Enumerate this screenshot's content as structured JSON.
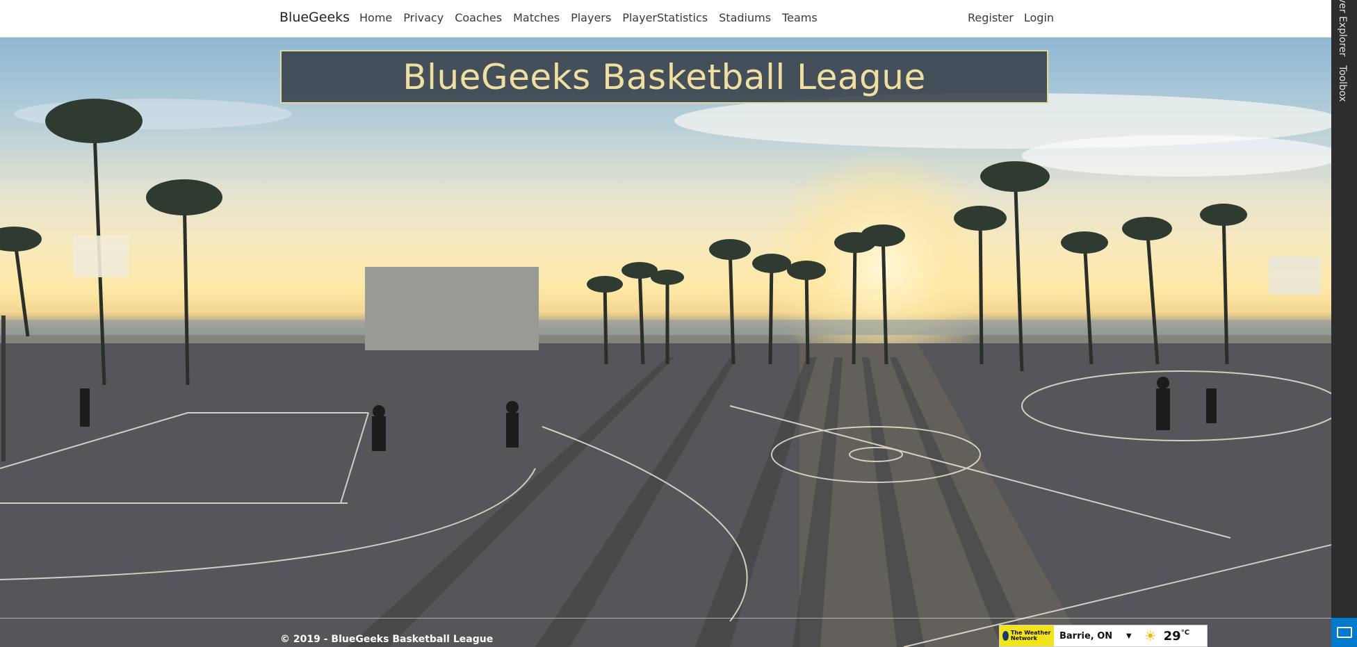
{
  "navbar": {
    "brand": "BlueGeeks",
    "links": [
      "Home",
      "Privacy",
      "Coaches",
      "Matches",
      "Players",
      "PlayerStatistics",
      "Stadiums",
      "Teams"
    ],
    "right_links": [
      "Register",
      "Login"
    ]
  },
  "hero": {
    "title": "BlueGeeks Basketball League",
    "scene": "outdoor-basketball-courts-sunset"
  },
  "footer": {
    "text": "© 2019 - BlueGeeks Basketball League"
  },
  "weather": {
    "provider": "The Weather Network",
    "city": "Barrie, ON",
    "temp": "29",
    "unit": "°C",
    "icon": "sun-icon"
  },
  "side_panel": {
    "tabs": [
      "ver Explorer",
      "Toolbox"
    ]
  },
  "colors": {
    "banner_bg": "#373f49",
    "banner_border": "#e6d79a",
    "title": "#efe0a2",
    "widget_accent": "#f2e31b",
    "ide_blue": "#007acc"
  }
}
